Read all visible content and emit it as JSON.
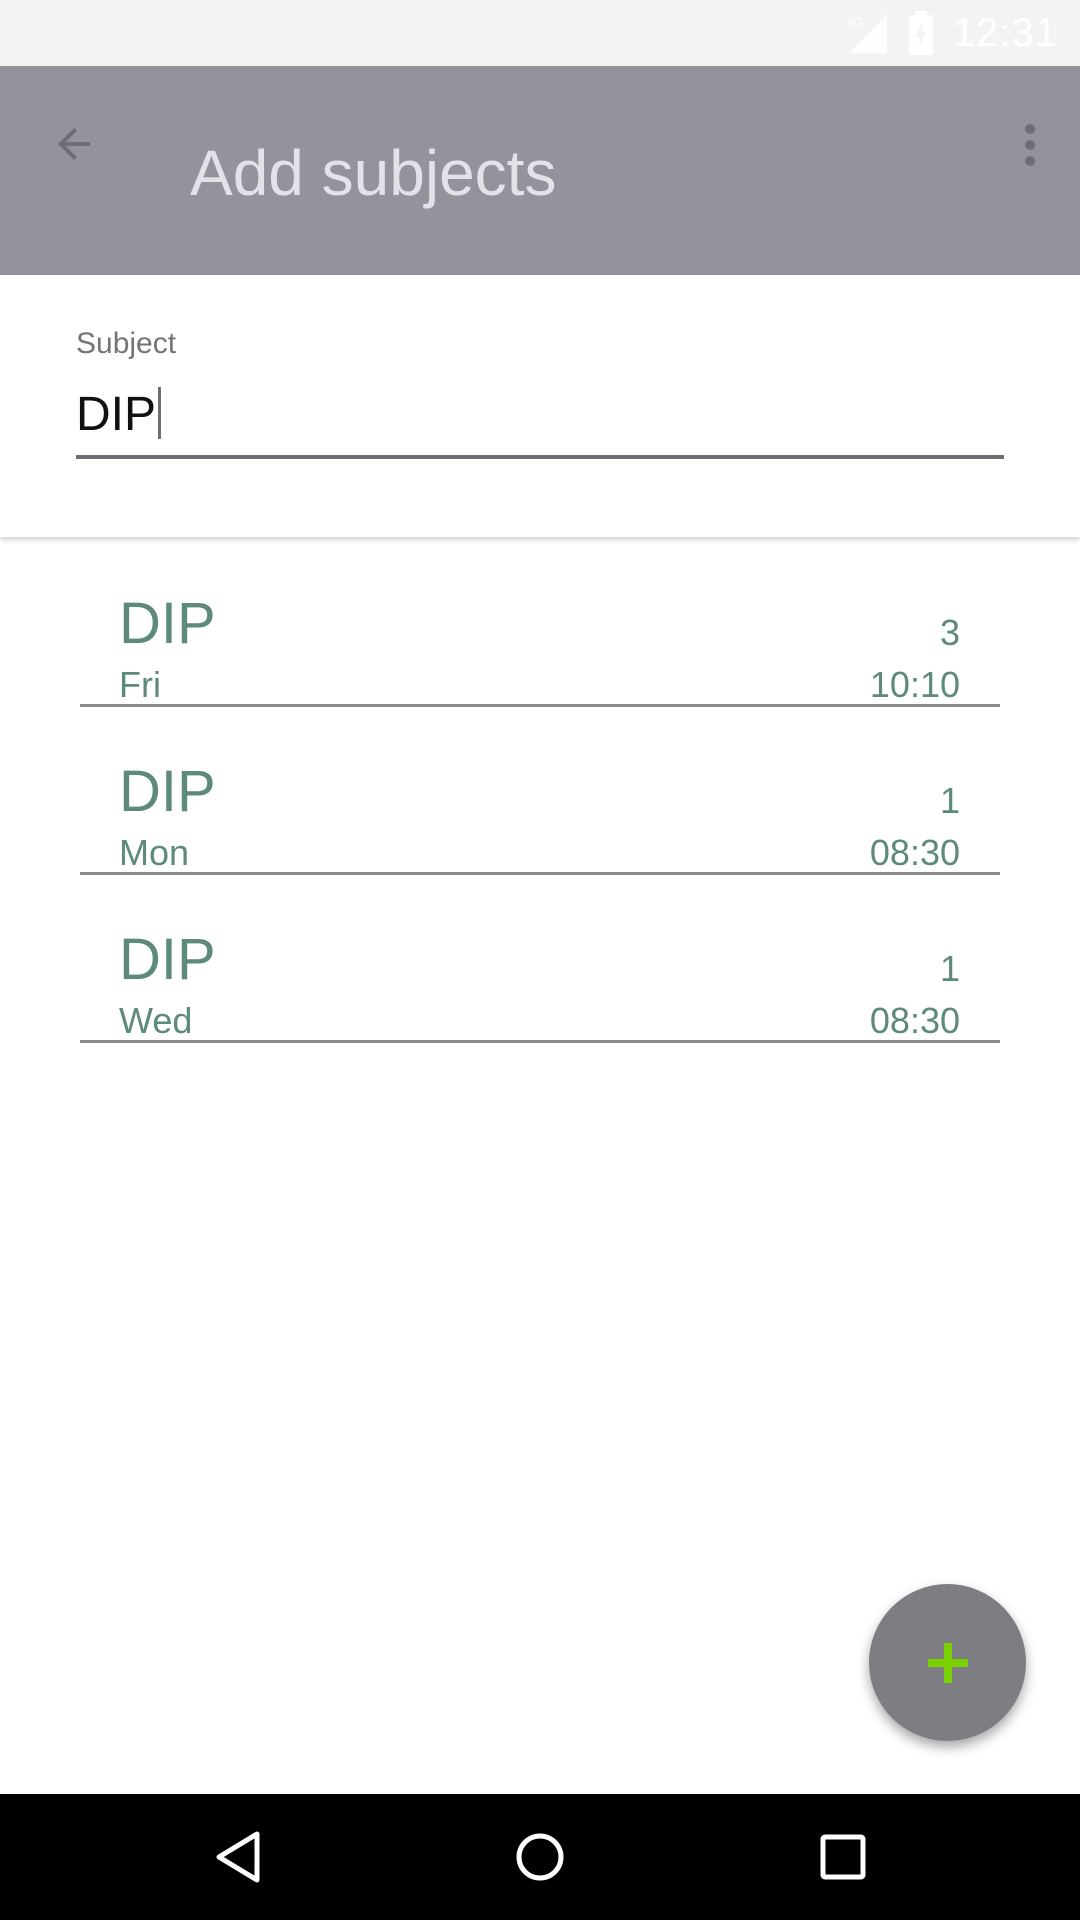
{
  "status_bar": {
    "network_label": "3G",
    "time": "12:31"
  },
  "toolbar": {
    "title": "Add subjects"
  },
  "subject_field": {
    "label": "Subject",
    "value": "DIP"
  },
  "subjects": [
    {
      "name": "DIP",
      "count": "3",
      "day": "Fri",
      "time": "10:10"
    },
    {
      "name": "DIP",
      "count": "1",
      "day": "Mon",
      "time": "08:30"
    },
    {
      "name": "DIP",
      "count": "1",
      "day": "Wed",
      "time": "08:30"
    }
  ],
  "colors": {
    "toolbar": "#94929c",
    "item_text": "#5d8a79",
    "fab": "#7e7d83",
    "fab_icon": "#7bd000"
  },
  "icons": {
    "back": "arrow-back-icon",
    "more": "more-vert-icon",
    "fab": "plus-icon",
    "nav_back": "nav-back-icon",
    "nav_home": "nav-home-icon",
    "nav_recents": "nav-recents-icon"
  }
}
